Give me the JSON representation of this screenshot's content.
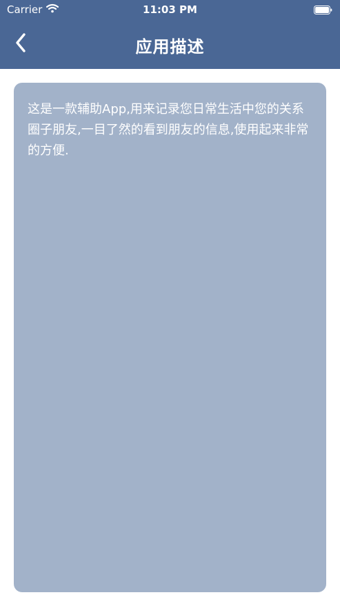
{
  "status_bar": {
    "carrier": "Carrier",
    "time": "11:03 PM",
    "icons": [
      "wifi-icon",
      "battery-icon"
    ]
  },
  "nav": {
    "back_icon": "chevron-left-icon",
    "title": "应用描述"
  },
  "content": {
    "description": "这是一款辅助App,用来记录您日常生活中您的关系圈子朋友,一目了然的看到朋友的信息,使用起来非常的方便."
  },
  "colors": {
    "header_bg": "#4a6795",
    "card_bg": "#a2b2c9",
    "text": "#ffffff",
    "page_bg": "#ffffff"
  }
}
